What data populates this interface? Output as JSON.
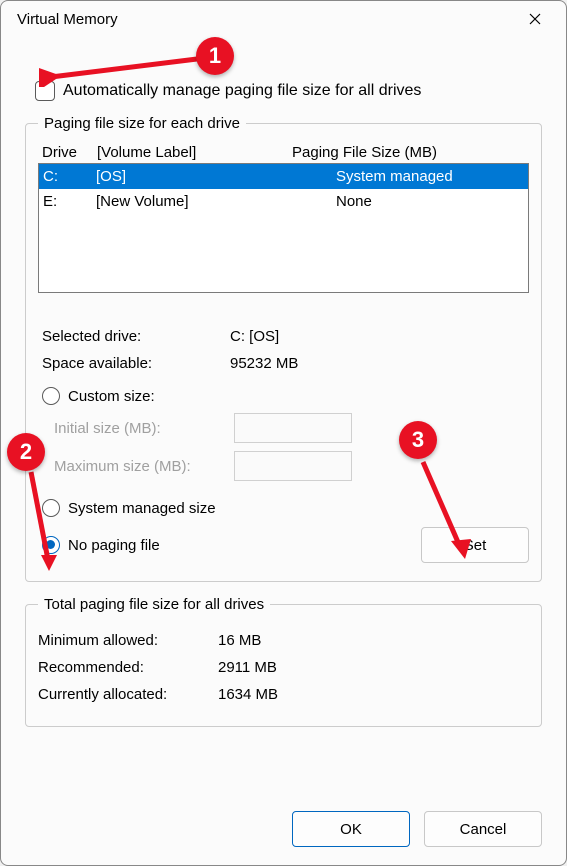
{
  "title": "Virtual Memory",
  "auto_manage_label": "Automatically manage paging file size for all drives",
  "auto_manage_checked": false,
  "group1_title": "Paging file size for each drive",
  "columns": {
    "drive": "Drive",
    "label": "[Volume Label]",
    "size": "Paging File Size (MB)"
  },
  "drives": [
    {
      "letter": "C:",
      "label": "[OS]",
      "size": "System managed",
      "selected": true
    },
    {
      "letter": "E:",
      "label": "[New Volume]",
      "size": "None",
      "selected": false
    }
  ],
  "selected_drive_label": "Selected drive:",
  "selected_drive_value": "C:  [OS]",
  "space_available_label": "Space available:",
  "space_available_value": "95232 MB",
  "radio_custom": "Custom size:",
  "initial_label": "Initial size (MB):",
  "maximum_label": "Maximum size (MB):",
  "radio_system": "System managed size",
  "radio_none": "No paging file",
  "selected_mode": "none",
  "set_button": "Set",
  "group2_title": "Total paging file size for all drives",
  "min_allowed_label": "Minimum allowed:",
  "min_allowed_value": "16 MB",
  "recommended_label": "Recommended:",
  "recommended_value": "2911 MB",
  "current_label": "Currently allocated:",
  "current_value": "1634 MB",
  "ok_button": "OK",
  "cancel_button": "Cancel",
  "annotations": {
    "a1": "1",
    "a2": "2",
    "a3": "3"
  }
}
